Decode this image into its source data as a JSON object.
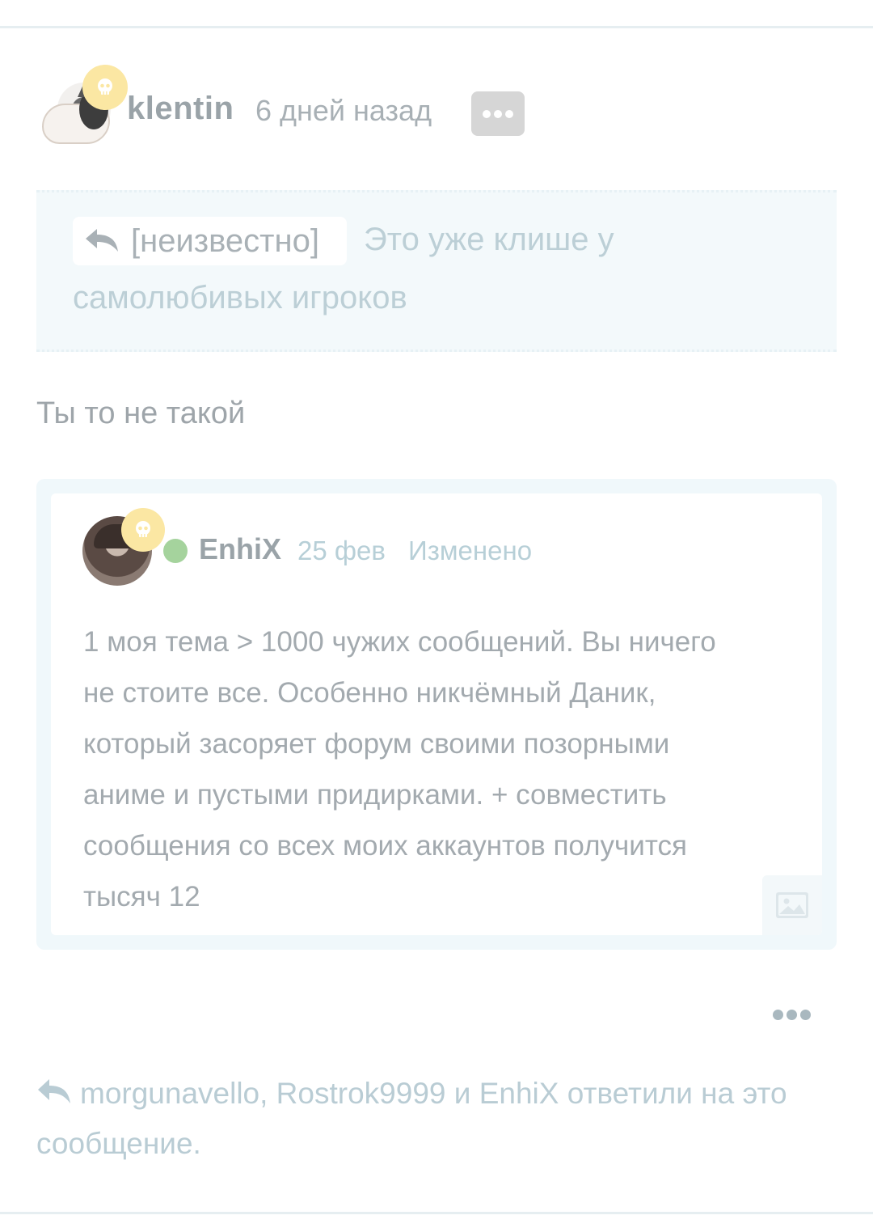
{
  "post": {
    "author": "klentin",
    "time": "6 дней назад",
    "quote": {
      "source_label": "[неизвестно]",
      "line1": "Это уже клише у",
      "line2": "самолюбивых игроков"
    },
    "message": "Ты то не такой",
    "embed": {
      "author": "EnhiX",
      "date": "25 фев",
      "edited_label": "Изменено",
      "lines": [
        "1 моя тема > 1000 чужих сообщений. Вы ничего",
        "не стоите все. Особенно никчёмный Даник,",
        "который засоряет форум своими позорными",
        "аниме и пустыми придирками. + совместить",
        "сообщения со всех моих аккаунтов получится",
        "тысяч 12"
      ]
    },
    "replies_text": "morgunavello, Rostrok9999 и EnhiX ответили на это сообщение."
  },
  "colors": {
    "badge": "#fbe7a3",
    "online": "#a5d39d",
    "quote_bg": "#f3f9fb",
    "menu_btn": "#d6d6d6"
  },
  "icons": {
    "badge": "skull-icon",
    "menu": "more-dots-icon",
    "reply": "reply-arrow-icon",
    "image": "image-icon"
  }
}
